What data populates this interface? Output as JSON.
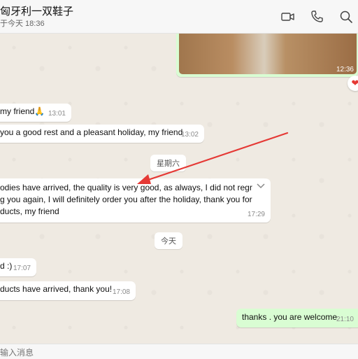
{
  "header": {
    "title": "匈牙利一双鞋子",
    "subtitle": "于今天 18:36"
  },
  "icons": {
    "video_call": "video-camera-icon",
    "voice_call": "phone-icon",
    "search": "search-icon",
    "reaction": "heart-icon",
    "menu": "chevron-down-icon"
  },
  "messages": {
    "image_time": "12:36",
    "reaction": "❤",
    "m1_text": "my friend🙏",
    "m1_time": "13:01",
    "m2_text": "you a good rest and a pleasant holiday, my friend",
    "m2_time": "13:02",
    "date1": "星期六",
    "m3_line1": "odies have arrived, the quality is very good, as always, I did not regr",
    "m3_line2": "g you again, I will definitely order you after the holiday, thank you for",
    "m3_line3": "ducts, my friend",
    "m3_time": "17:29",
    "date2": "今天",
    "m4_text": "d :)",
    "m4_time": "17:07",
    "m5_text": "ducts have arrived, thank you!",
    "m5_time": "17:08",
    "m6_text": "thanks . you are welcome",
    "m6_time": "21:10"
  },
  "composer": {
    "placeholder": "输入消息"
  },
  "colors": {
    "background": "#efeae2",
    "incoming": "#ffffff",
    "outgoing": "#d9fdd3",
    "annotation_arrow": "#e53935"
  }
}
